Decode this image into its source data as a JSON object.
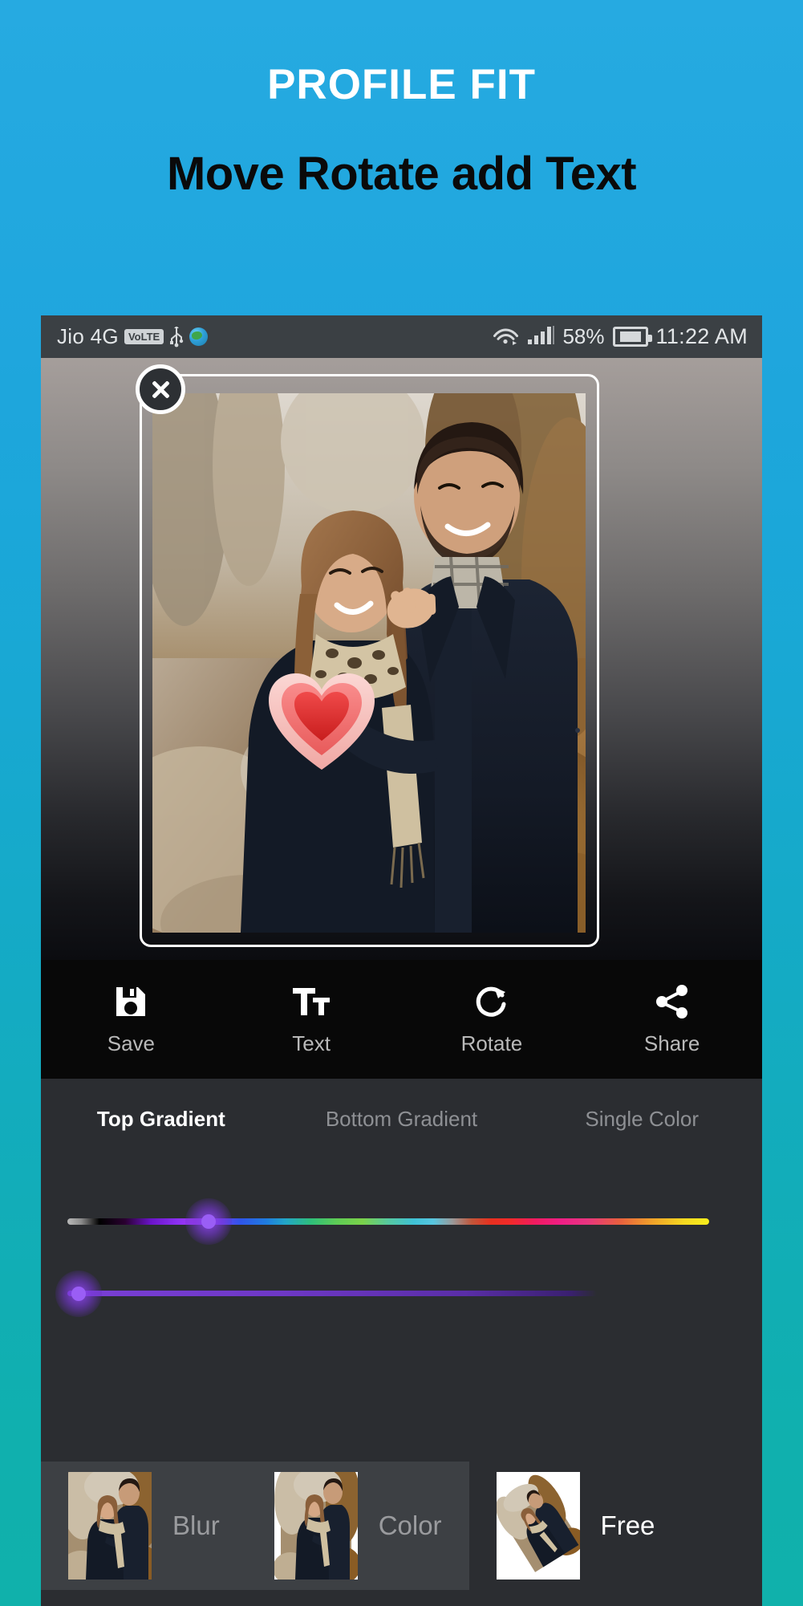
{
  "promo": {
    "title": "PROFILE FIT",
    "subtitle": "Move Rotate add Text"
  },
  "colors": {
    "bg_top": "#26aae1",
    "bg_bottom": "#10b1ab",
    "panel": "#2b2d31",
    "toolbar": "#080808",
    "statusbar": "#3b4044",
    "accent_thumb": "#9a5ef5",
    "active_text": "#ffffff",
    "inactive_text": "#8e9094"
  },
  "statusbar": {
    "carrier": "Jio 4G",
    "volte_badge": "VoLTE",
    "usb_icon": "usb-icon",
    "globe_icon": "globe-icon",
    "wifi_icon": "wifi-icon",
    "signal_icon": "signal-bars-icon",
    "battery_percent": "58%",
    "battery_icon": "battery-charging-icon",
    "time": "11:22 AM"
  },
  "editor": {
    "close_icon": "close-icon",
    "photo_alt": "couple-photo",
    "sticker": "heart-sticker"
  },
  "toolbar": {
    "items": [
      {
        "label": "Save",
        "icon": "save-icon"
      },
      {
        "label": "Text",
        "icon": "text-format-icon"
      },
      {
        "label": "Rotate",
        "icon": "rotate-cw-icon"
      },
      {
        "label": "Share",
        "icon": "share-icon"
      }
    ]
  },
  "tabs": {
    "items": [
      {
        "label": "Top Gradient",
        "active": true
      },
      {
        "label": "Bottom Gradient",
        "active": false
      },
      {
        "label": "Single Color",
        "active": false
      }
    ]
  },
  "sliders": {
    "hue": {
      "name": "hue-slider",
      "value_percent": 22
    },
    "shade": {
      "name": "shade-slider",
      "value_percent": 3
    }
  },
  "modebar": {
    "items": [
      {
        "label": "Blur",
        "selected": true,
        "thumb": "blur-preview-thumbnail"
      },
      {
        "label": "Color",
        "selected": true,
        "thumb": "color-preview-thumbnail"
      },
      {
        "label": "Free",
        "selected": false,
        "thumb": "free-preview-thumbnail"
      }
    ]
  }
}
